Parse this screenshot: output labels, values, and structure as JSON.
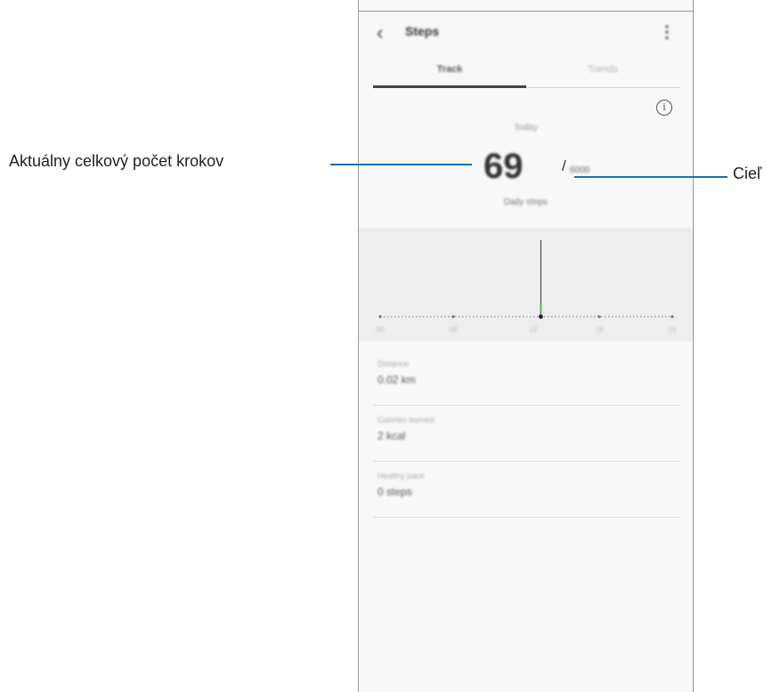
{
  "app": {
    "title": "Steps",
    "back_icon": "chevron-left-icon",
    "more_icon": "more-vert-icon"
  },
  "tabs": [
    {
      "label": "Track",
      "active": true
    },
    {
      "label": "Trends",
      "active": false
    }
  ],
  "summary": {
    "info_icon": "info-icon",
    "period": "Today",
    "steps": "69",
    "separator": "/",
    "goal": "6000",
    "caption": "Daily steps"
  },
  "chart_data": {
    "type": "bar",
    "x_tick_labels": [
      "00",
      "06",
      "12",
      "18",
      "24"
    ],
    "current_position": 0.55,
    "accent_color": "#5cb85c"
  },
  "stats": [
    {
      "label": "Distance",
      "value": "0.02 km"
    },
    {
      "label": "Calories burned",
      "value": "2 kcal"
    },
    {
      "label": "Healthy pace",
      "value": "0 steps"
    }
  ],
  "callouts": {
    "left": "Aktuálny celkový počet krokov",
    "right": "Cieľ"
  },
  "colors": {
    "callout_line": "#1a6fa8",
    "tab_indicator": "#444444"
  }
}
